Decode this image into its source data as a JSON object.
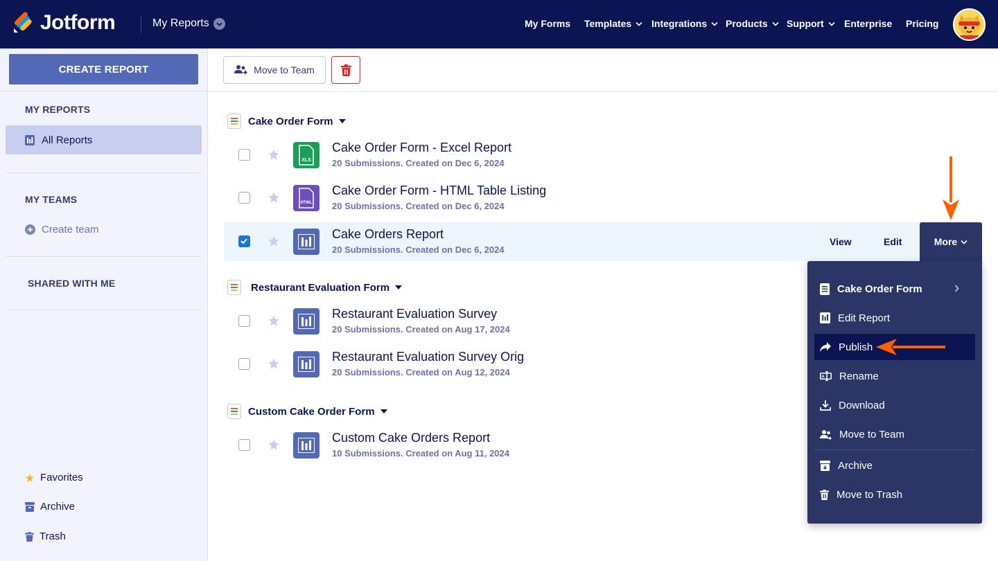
{
  "brand": {
    "name": "Jotform"
  },
  "header": {
    "section_title": "My Reports",
    "nav": [
      {
        "label": "My Forms",
        "dropdown": false
      },
      {
        "label": "Templates",
        "dropdown": true
      },
      {
        "label": "Integrations",
        "dropdown": true
      },
      {
        "label": "Products",
        "dropdown": true
      },
      {
        "label": "Support",
        "dropdown": true
      },
      {
        "label": "Enterprise",
        "dropdown": false
      },
      {
        "label": "Pricing",
        "dropdown": false
      }
    ]
  },
  "sidebar": {
    "create_button": "CREATE REPORT",
    "my_reports_heading": "MY REPORTS",
    "all_reports": "All Reports",
    "my_teams_heading": "MY TEAMS",
    "create_team": "Create team",
    "shared_heading": "SHARED WITH ME",
    "favorites": "Favorites",
    "archive": "Archive",
    "trash": "Trash"
  },
  "toolbar": {
    "move_to_team": "Move to Team"
  },
  "groups": [
    {
      "form_name": "Cake Order Form",
      "reports": [
        {
          "title": "Cake Order Form - Excel Report",
          "meta": "20 Submissions. Created on Dec 6, 2024",
          "type": "xls",
          "icon_label": "XLS",
          "checked": false
        },
        {
          "title": "Cake Order Form - HTML Table Listing",
          "meta": "20 Submissions. Created on Dec 6, 2024",
          "type": "html",
          "icon_label": "HTML",
          "checked": false
        },
        {
          "title": "Cake Orders Report",
          "meta": "20 Submissions. Created on Dec 6, 2024",
          "type": "chart",
          "checked": true
        }
      ]
    },
    {
      "form_name": "Restaurant Evaluation Form",
      "reports": [
        {
          "title": "Restaurant Evaluation Survey",
          "meta": "20 Submissions. Created on Aug 17, 2024",
          "type": "chart",
          "checked": false
        },
        {
          "title": "Restaurant Evaluation Survey Orig",
          "meta": "20 Submissions. Created on Aug 12, 2024",
          "type": "chart",
          "checked": false
        }
      ]
    },
    {
      "form_name": "Custom Cake Order Form",
      "reports": [
        {
          "title": "Custom Cake Orders Report",
          "meta": "10 Submissions. Created on Aug 11, 2024",
          "type": "chart",
          "checked": false
        }
      ]
    }
  ],
  "row_actions": {
    "view": "View",
    "edit": "Edit",
    "more": "More"
  },
  "more_menu": [
    {
      "label": "Cake Order Form",
      "icon": "form-icon",
      "submenu": true
    },
    {
      "label": "Edit Report",
      "icon": "report-icon"
    },
    {
      "label": "Publish",
      "icon": "share-arrow-icon",
      "highlighted": true
    },
    {
      "label": "Rename",
      "icon": "rename-icon"
    },
    {
      "label": "Download",
      "icon": "download-icon"
    },
    {
      "label": "Move to Team",
      "icon": "team-icon"
    },
    {
      "label": "Archive",
      "icon": "archive-icon"
    },
    {
      "label": "Move to Trash",
      "icon": "trash-icon"
    }
  ],
  "colors": {
    "header_bg": "#0a1551",
    "sidebar_bg": "#f3f3fe",
    "primary_button": "#5369b5",
    "menu_bg": "#2b3566",
    "annotation_arrow": "#ff6100",
    "xls_icon": "#1b9e5c",
    "html_icon": "#6b4fbb",
    "chart_icon": "#5369b5"
  }
}
